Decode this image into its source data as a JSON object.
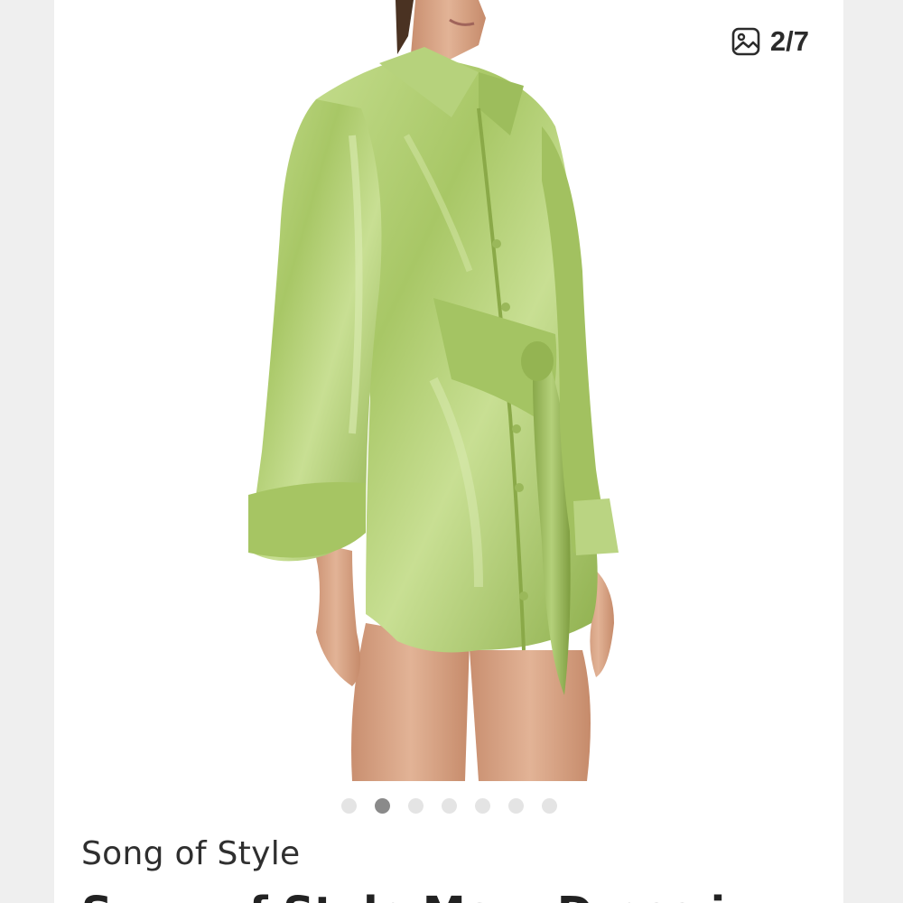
{
  "gallery": {
    "counter": "2/7",
    "counter_icon": "image-icon",
    "total_dots": 7,
    "active_index": 1
  },
  "listing": {
    "brand": "Song of Style",
    "title": "Song of Style Marc Dress in"
  },
  "colors": {
    "dress": "#a9c86a",
    "dress_shadow": "#7c9a3f",
    "skin": "#dba98b",
    "hair": "#4a3222",
    "dot_active": "#8a8a8a",
    "dot_inactive": "#e4e4e4"
  }
}
